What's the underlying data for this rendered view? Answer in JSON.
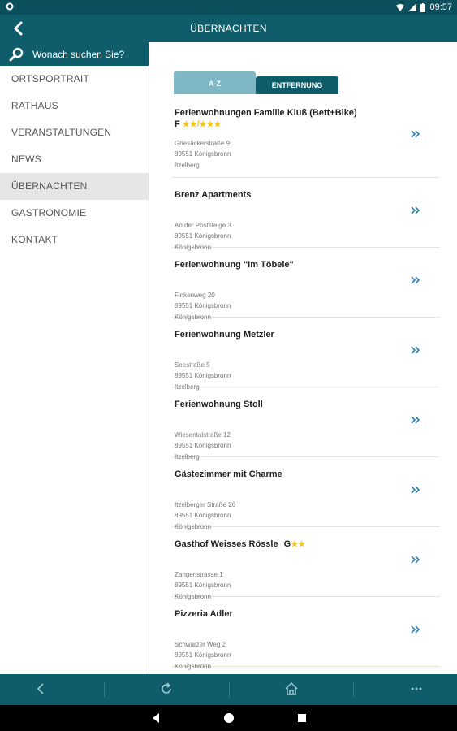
{
  "status": {
    "time": "09:57"
  },
  "header": {
    "title": "ÜBERNACHTEN"
  },
  "sidebar": {
    "search_placeholder": "Wonach suchen Sie?",
    "items": [
      {
        "label": "ORTSPORTRAIT"
      },
      {
        "label": "RATHAUS"
      },
      {
        "label": "VERANSTALTUNGEN"
      },
      {
        "label": "NEWS"
      },
      {
        "label": "ÜBERNACHTEN",
        "active": true
      },
      {
        "label": "GASTRONOMIE"
      },
      {
        "label": "KONTAKT"
      }
    ]
  },
  "tabs": {
    "az": "A-Z",
    "distance": "ENTFERNUNG"
  },
  "accommodations": [
    {
      "name": "Ferienwohnungen Familie Kluß (Bett+Bike)",
      "class": "F",
      "stars": "★★/★★★",
      "street": "Griesäckerstraße 9",
      "zip_city": "89551 Königsbronn",
      "district": "Itzelberg"
    },
    {
      "name": "Brenz Apartments",
      "street": "An der Poststeige 3",
      "zip_city": "89551 Königsbronn",
      "district": "Königsbronn"
    },
    {
      "name": "Ferienwohnung \"Im Töbele\"",
      "street": "Finkenweg 20",
      "zip_city": "89551 Königsbronn",
      "district": "Königsbronn"
    },
    {
      "name": "Ferienwohnung Metzler",
      "street": "Seestraße 5",
      "zip_city": "89551 Königsbronn",
      "district": "Itzelberg"
    },
    {
      "name": "Ferienwohnung Stoll",
      "street": "Wiesentalstraße 12",
      "zip_city": "89551 Königsbronn",
      "district": "Itzelberg"
    },
    {
      "name": "Gästezimmer mit Charme",
      "street": "Itzelberger Straße 26",
      "zip_city": "89551 Königsbronn",
      "district": "Königsbronn"
    },
    {
      "name": "Gasthof Weisses Rössle",
      "class": "G",
      "stars": "★★",
      "street": "Zangenstrasse 1",
      "zip_city": "89551 Königsbronn",
      "district": "Königsbronn"
    },
    {
      "name": "Pizzeria Adler",
      "street": "Schwarzer Weg 2",
      "zip_city": "89551 Königsbronn",
      "district": "Königsbronn"
    }
  ],
  "colors": {
    "primary": "#0f5d6b",
    "tab_light": "#7fb8c4",
    "star": "#f2c319",
    "link": "#2a7fb8"
  }
}
